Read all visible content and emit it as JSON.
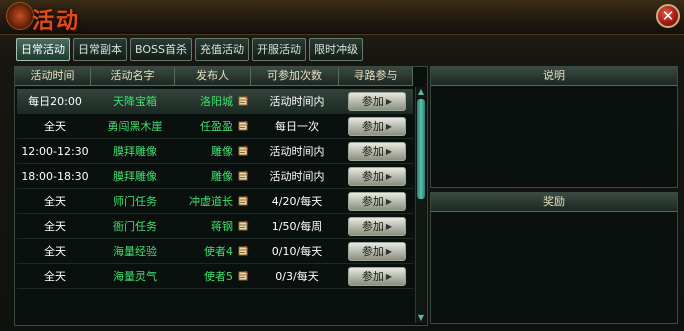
{
  "window": {
    "title": "活动"
  },
  "tabs": [
    {
      "label": "日常活动",
      "active": true
    },
    {
      "label": "日常副本",
      "active": false
    },
    {
      "label": "BOSS首杀",
      "active": false
    },
    {
      "label": "充值活动",
      "active": false
    },
    {
      "label": "开服活动",
      "active": false
    },
    {
      "label": "限时冲级",
      "active": false
    }
  ],
  "table": {
    "headers": [
      "活动时间",
      "活动名字",
      "发布人",
      "可参加次数",
      "寻路参与"
    ],
    "rows": [
      {
        "time": "每日20:00",
        "name": "天降宝箱",
        "publisher": "洛阳城",
        "count": "活动时间内",
        "button": "参加"
      },
      {
        "time": "全天",
        "name": "勇闯黑木崖",
        "publisher": "任盈盈",
        "count": "每日一次",
        "button": "参加"
      },
      {
        "time": "12:00-12:30",
        "name": "膜拜雕像",
        "publisher": "雕像",
        "count": "活动时间内",
        "button": "参加"
      },
      {
        "time": "18:00-18:30",
        "name": "膜拜雕像",
        "publisher": "雕像",
        "count": "活动时间内",
        "button": "参加"
      },
      {
        "time": "全天",
        "name": "师门任务",
        "publisher": "冲虚道长",
        "count": "4/20/每天",
        "button": "参加"
      },
      {
        "time": "全天",
        "name": "衙门任务",
        "publisher": "蒋钢",
        "count": "1/50/每周",
        "button": "参加"
      },
      {
        "time": "全天",
        "name": "海量经验",
        "publisher": "使者4",
        "count": "0/10/每天",
        "button": "参加"
      },
      {
        "time": "全天",
        "name": "海量灵气",
        "publisher": "使者5",
        "count": "0/3/每天",
        "button": "参加"
      }
    ]
  },
  "right": {
    "description_title": "说明",
    "reward_title": "奖励"
  },
  "icons": {
    "row_icon": "scroll-icon",
    "close": "close-icon"
  },
  "colors": {
    "accent_green": "#40e070",
    "title_red": "#e04a1a"
  }
}
